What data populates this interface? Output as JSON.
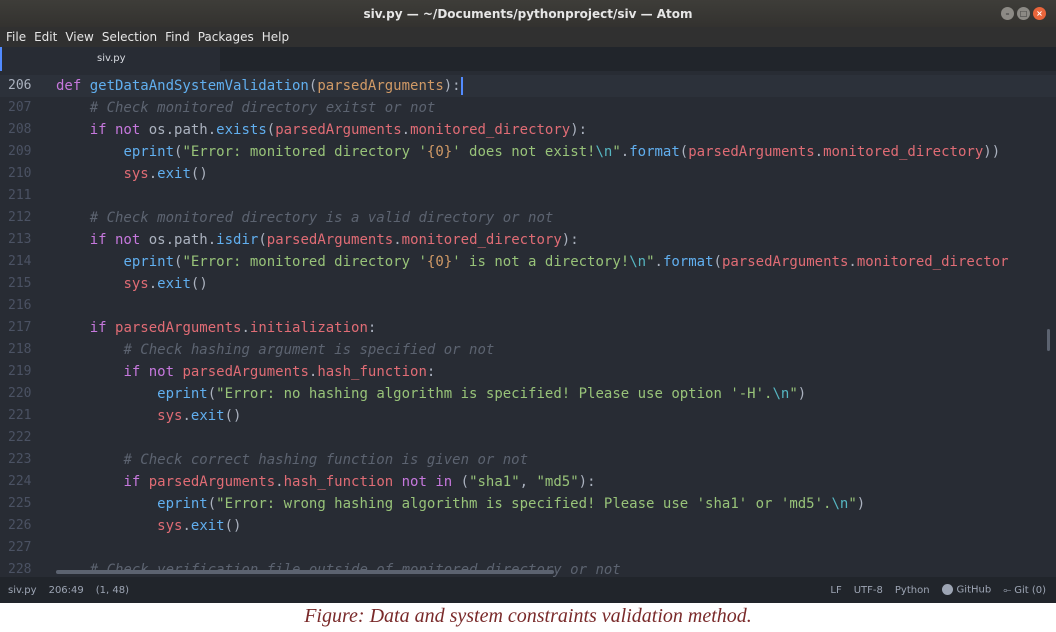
{
  "window": {
    "title": "siv.py — ~/Documents/pythonproject/siv — Atom"
  },
  "menu": [
    "File",
    "Edit",
    "View",
    "Selection",
    "Find",
    "Packages",
    "Help"
  ],
  "tab": {
    "label": "siv.py"
  },
  "lines": [
    {
      "num": "206",
      "tokens": [
        {
          "t": "def ",
          "c": "k"
        },
        {
          "t": "getDataAndSystemValidation",
          "c": "f"
        },
        {
          "t": "(",
          "c": "o"
        },
        {
          "t": "parsedArguments",
          "c": "par"
        },
        {
          "t": "):",
          "c": "o"
        }
      ]
    },
    {
      "num": "207",
      "tokens": [
        {
          "t": "    ",
          "c": "o"
        },
        {
          "t": "# Check monitored directory exitst or not",
          "c": "c"
        }
      ]
    },
    {
      "num": "208",
      "tokens": [
        {
          "t": "    ",
          "c": "o"
        },
        {
          "t": "if not ",
          "c": "k"
        },
        {
          "t": "os.path.",
          "c": "o"
        },
        {
          "t": "exists",
          "c": "f"
        },
        {
          "t": "(",
          "c": "o"
        },
        {
          "t": "parsedArguments",
          "c": "p"
        },
        {
          "t": ".",
          "c": "o"
        },
        {
          "t": "monitored_directory",
          "c": "p"
        },
        {
          "t": "):",
          "c": "o"
        }
      ]
    },
    {
      "num": "209",
      "tokens": [
        {
          "t": "        ",
          "c": "o"
        },
        {
          "t": "eprint",
          "c": "f"
        },
        {
          "t": "(",
          "c": "o"
        },
        {
          "t": "\"Error: monitored directory '",
          "c": "s"
        },
        {
          "t": "{0}",
          "c": "par"
        },
        {
          "t": "' does not exist!",
          "c": "s"
        },
        {
          "t": "\\n",
          "c": "e"
        },
        {
          "t": "\"",
          "c": "s"
        },
        {
          "t": ".",
          "c": "o"
        },
        {
          "t": "format",
          "c": "f"
        },
        {
          "t": "(",
          "c": "o"
        },
        {
          "t": "parsedArguments",
          "c": "p"
        },
        {
          "t": ".",
          "c": "o"
        },
        {
          "t": "monitored_directory",
          "c": "p"
        },
        {
          "t": "))",
          "c": "o"
        }
      ]
    },
    {
      "num": "210",
      "tokens": [
        {
          "t": "        ",
          "c": "o"
        },
        {
          "t": "sys",
          "c": "p"
        },
        {
          "t": ".",
          "c": "o"
        },
        {
          "t": "exit",
          "c": "f"
        },
        {
          "t": "()",
          "c": "o"
        }
      ]
    },
    {
      "num": "211",
      "tokens": []
    },
    {
      "num": "212",
      "tokens": [
        {
          "t": "    ",
          "c": "o"
        },
        {
          "t": "# Check monitored directory is a valid directory or not",
          "c": "c"
        }
      ]
    },
    {
      "num": "213",
      "tokens": [
        {
          "t": "    ",
          "c": "o"
        },
        {
          "t": "if not ",
          "c": "k"
        },
        {
          "t": "os.path.",
          "c": "o"
        },
        {
          "t": "isdir",
          "c": "f"
        },
        {
          "t": "(",
          "c": "o"
        },
        {
          "t": "parsedArguments",
          "c": "p"
        },
        {
          "t": ".",
          "c": "o"
        },
        {
          "t": "monitored_directory",
          "c": "p"
        },
        {
          "t": "):",
          "c": "o"
        }
      ]
    },
    {
      "num": "214",
      "tokens": [
        {
          "t": "        ",
          "c": "o"
        },
        {
          "t": "eprint",
          "c": "f"
        },
        {
          "t": "(",
          "c": "o"
        },
        {
          "t": "\"Error: monitored directory '",
          "c": "s"
        },
        {
          "t": "{0}",
          "c": "par"
        },
        {
          "t": "' is not a directory!",
          "c": "s"
        },
        {
          "t": "\\n",
          "c": "e"
        },
        {
          "t": "\"",
          "c": "s"
        },
        {
          "t": ".",
          "c": "o"
        },
        {
          "t": "format",
          "c": "f"
        },
        {
          "t": "(",
          "c": "o"
        },
        {
          "t": "parsedArguments",
          "c": "p"
        },
        {
          "t": ".",
          "c": "o"
        },
        {
          "t": "monitored_director",
          "c": "p"
        }
      ]
    },
    {
      "num": "215",
      "tokens": [
        {
          "t": "        ",
          "c": "o"
        },
        {
          "t": "sys",
          "c": "p"
        },
        {
          "t": ".",
          "c": "o"
        },
        {
          "t": "exit",
          "c": "f"
        },
        {
          "t": "()",
          "c": "o"
        }
      ]
    },
    {
      "num": "216",
      "tokens": []
    },
    {
      "num": "217",
      "tokens": [
        {
          "t": "    ",
          "c": "o"
        },
        {
          "t": "if ",
          "c": "k"
        },
        {
          "t": "parsedArguments",
          "c": "p"
        },
        {
          "t": ".",
          "c": "o"
        },
        {
          "t": "initialization",
          "c": "p"
        },
        {
          "t": ":",
          "c": "o"
        }
      ]
    },
    {
      "num": "218",
      "tokens": [
        {
          "t": "        ",
          "c": "o"
        },
        {
          "t": "# Check hashing argument is specified or not",
          "c": "c"
        }
      ]
    },
    {
      "num": "219",
      "tokens": [
        {
          "t": "        ",
          "c": "o"
        },
        {
          "t": "if not ",
          "c": "k"
        },
        {
          "t": "parsedArguments",
          "c": "p"
        },
        {
          "t": ".",
          "c": "o"
        },
        {
          "t": "hash_function",
          "c": "p"
        },
        {
          "t": ":",
          "c": "o"
        }
      ]
    },
    {
      "num": "220",
      "tokens": [
        {
          "t": "            ",
          "c": "o"
        },
        {
          "t": "eprint",
          "c": "f"
        },
        {
          "t": "(",
          "c": "o"
        },
        {
          "t": "\"Error: no hashing algorithm is specified! Please use option '-H'.",
          "c": "s"
        },
        {
          "t": "\\n",
          "c": "e"
        },
        {
          "t": "\"",
          "c": "s"
        },
        {
          "t": ")",
          "c": "o"
        }
      ]
    },
    {
      "num": "221",
      "tokens": [
        {
          "t": "            ",
          "c": "o"
        },
        {
          "t": "sys",
          "c": "p"
        },
        {
          "t": ".",
          "c": "o"
        },
        {
          "t": "exit",
          "c": "f"
        },
        {
          "t": "()",
          "c": "o"
        }
      ]
    },
    {
      "num": "222",
      "tokens": []
    },
    {
      "num": "223",
      "tokens": [
        {
          "t": "        ",
          "c": "o"
        },
        {
          "t": "# Check correct hashing function is given or not",
          "c": "c"
        }
      ]
    },
    {
      "num": "224",
      "tokens": [
        {
          "t": "        ",
          "c": "o"
        },
        {
          "t": "if ",
          "c": "k"
        },
        {
          "t": "parsedArguments",
          "c": "p"
        },
        {
          "t": ".",
          "c": "o"
        },
        {
          "t": "hash_function",
          "c": "p"
        },
        {
          "t": " not in ",
          "c": "k"
        },
        {
          "t": "(",
          "c": "o"
        },
        {
          "t": "\"sha1\"",
          "c": "s"
        },
        {
          "t": ", ",
          "c": "o"
        },
        {
          "t": "\"md5\"",
          "c": "s"
        },
        {
          "t": "):",
          "c": "o"
        }
      ]
    },
    {
      "num": "225",
      "tokens": [
        {
          "t": "            ",
          "c": "o"
        },
        {
          "t": "eprint",
          "c": "f"
        },
        {
          "t": "(",
          "c": "o"
        },
        {
          "t": "\"Error: wrong hashing algorithm is specified! Please use 'sha1' or 'md5'.",
          "c": "s"
        },
        {
          "t": "\\n",
          "c": "e"
        },
        {
          "t": "\"",
          "c": "s"
        },
        {
          "t": ")",
          "c": "o"
        }
      ]
    },
    {
      "num": "226",
      "tokens": [
        {
          "t": "            ",
          "c": "o"
        },
        {
          "t": "sys",
          "c": "p"
        },
        {
          "t": ".",
          "c": "o"
        },
        {
          "t": "exit",
          "c": "f"
        },
        {
          "t": "()",
          "c": "o"
        }
      ]
    },
    {
      "num": "227",
      "tokens": []
    },
    {
      "num": "228",
      "tokens": [
        {
          "t": "    ",
          "c": "o"
        },
        {
          "t": "# Check verification file outside of monitored directory or not",
          "c": "c"
        }
      ]
    }
  ],
  "status": {
    "file": "siv.py",
    "position": "206:49",
    "selection": "(1, 48)",
    "line_ending": "LF",
    "encoding": "UTF-8",
    "grammar": "Python",
    "github": "GitHub",
    "git": "Git (0)"
  },
  "caption": "Figure: Data and system constraints validation method.",
  "colors": {
    "background": "#282c34",
    "keyword": "#c678dd",
    "function": "#61afef",
    "variable": "#e06c75",
    "string": "#98c379",
    "comment": "#5c6370",
    "caption": "#7a2a2a"
  }
}
